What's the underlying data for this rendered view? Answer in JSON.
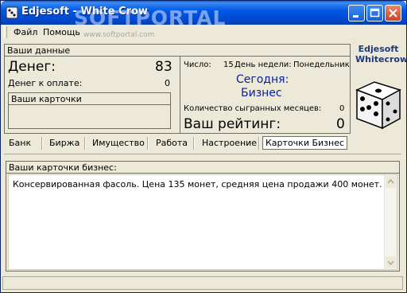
{
  "window": {
    "title": "Edjesoft - White Crow",
    "watermark": "SOFTPORTAL",
    "watermark_sub": "www.softportal.com"
  },
  "menu": {
    "file": "Файл",
    "help": "Помощь"
  },
  "your_data": {
    "header": "Ваши данные",
    "money_label": "Денег:",
    "money_value": "83",
    "to_pay_label": "Денег к оплате:",
    "to_pay_value": "0",
    "cards_header": "Ваши карточки"
  },
  "info": {
    "date_label": "Число:",
    "date_value": "15",
    "weekday_label": "День недели:",
    "weekday_value": "Понедельник",
    "today_label": "Сегодня:",
    "today_value": "Бизнес",
    "months_label": "Количество сыгранных месяцев:",
    "months_value": "0",
    "rating_label": "Ваш рейтинг:",
    "rating_value": "0"
  },
  "logo": {
    "line1": "Edjesoft",
    "line2": "Whitecrow"
  },
  "tabs": [
    {
      "label": "Банк"
    },
    {
      "label": "Биржа"
    },
    {
      "label": "Имущество"
    },
    {
      "label": "Работа"
    },
    {
      "label": "Настроение"
    },
    {
      "label": "Карточки Бизнес"
    }
  ],
  "active_tab": "Карточки Бизнес",
  "business_cards": {
    "header": "Ваши карточки бизнес:",
    "content": "Консервированная фасоль. Цена 135 монет, средняя цена продажи 400 монет."
  },
  "colors": {
    "accent": "#0058e6",
    "close": "#c8452b",
    "today_text": "#0a1f8f"
  }
}
